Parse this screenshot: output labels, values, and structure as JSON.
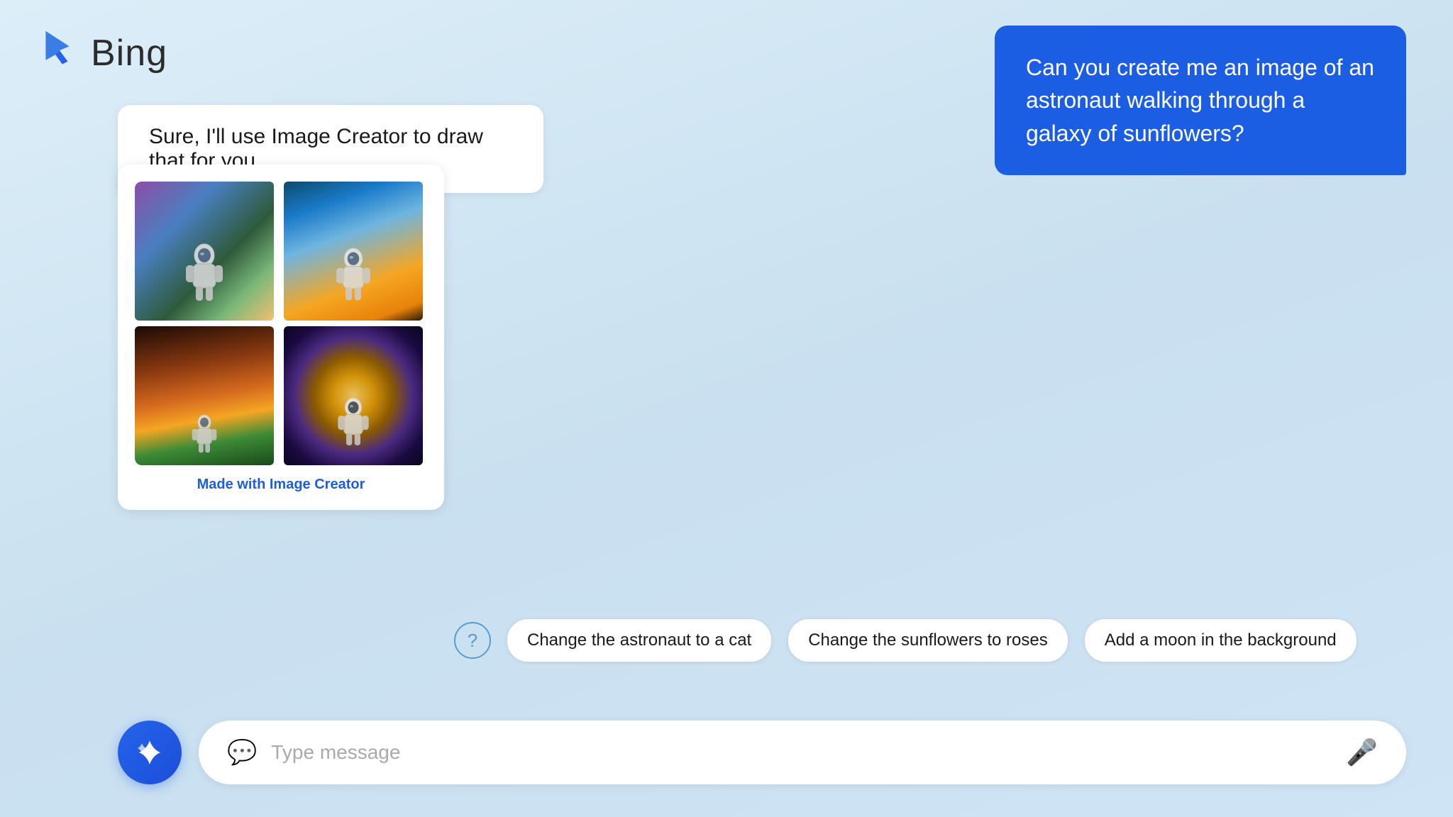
{
  "app": {
    "title": "Bing"
  },
  "header": {
    "logo_alt": "Bing logo",
    "title": "Bing"
  },
  "conversation": {
    "user_message": "Can you create me an image of an astronaut walking through a galaxy of sunflowers?",
    "bot_message": "Sure, I'll use Image Creator to draw that for you.",
    "image_credit_prefix": "Made with ",
    "image_credit_link": "Image Creator"
  },
  "suggestions": {
    "help_title": "Help",
    "chips": [
      {
        "id": "chip-1",
        "label": "Change the astronaut to a cat"
      },
      {
        "id": "chip-2",
        "label": "Change the sunflowers to roses"
      },
      {
        "id": "chip-3",
        "label": "Add a moon in the background"
      }
    ]
  },
  "input": {
    "placeholder": "Type message"
  }
}
